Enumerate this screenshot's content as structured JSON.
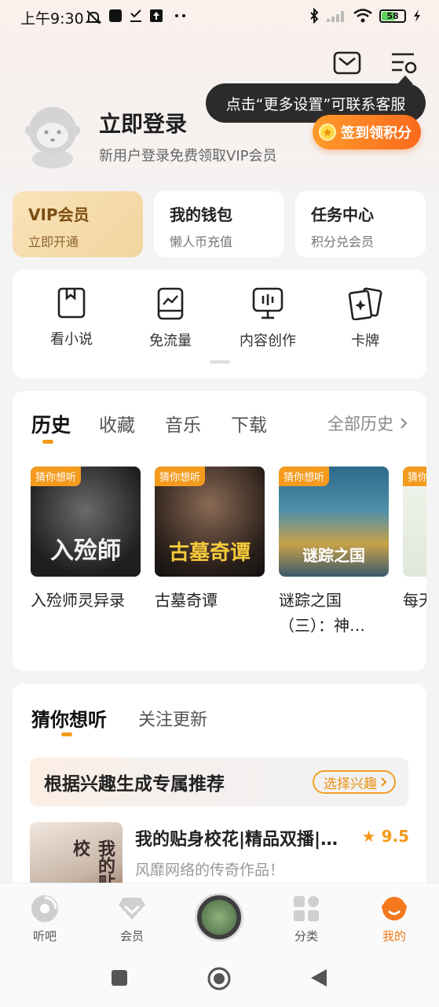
{
  "status": {
    "time": "上午9:30",
    "battery": "58"
  },
  "tooltip": {
    "text": "点击“更多设置”可联系客服"
  },
  "profile": {
    "login_title": "立即登录",
    "login_sub": "新用户登录免费领取VIP会员",
    "checkin_label": "签到领积分"
  },
  "quick": [
    {
      "title": "VIP会员",
      "sub": "立即开通"
    },
    {
      "title": "我的钱包",
      "sub": "懒人币充值"
    },
    {
      "title": "任务中心",
      "sub": "积分兑会员"
    }
  ],
  "features": [
    {
      "label": "看小说",
      "icon": "book-icon"
    },
    {
      "label": "免流量",
      "icon": "phone-traffic-icon"
    },
    {
      "label": "内容创作",
      "icon": "create-icon"
    },
    {
      "label": "卡牌",
      "icon": "cards-icon"
    }
  ],
  "history": {
    "tabs": [
      "历史",
      "收藏",
      "音乐",
      "下载"
    ],
    "all_label": "全部历史",
    "books": [
      {
        "tag": "猜你想听",
        "title": "入殓师灵异录",
        "cover_text": "入殓師",
        "cover_bg": "#3a3a3a"
      },
      {
        "tag": "猜你想听",
        "title": "古墓奇谭",
        "cover_text": "古墓奇谭",
        "cover_bg": "#2a2420"
      },
      {
        "tag": "猜你想听",
        "title": "谜踪之国（三）：神…",
        "cover_text": "谜踪之国",
        "cover_bg": "#3d6a86"
      },
      {
        "tag": "猜你想",
        "title": "每天学",
        "cover_text": "",
        "cover_bg": "#e8efe4"
      }
    ]
  },
  "guess": {
    "tabs": [
      "猜你想听",
      "关注更新"
    ],
    "interest_title": "根据兴趣生成专属推荐",
    "interest_button": "选择兴趣",
    "rec": {
      "title": "我的贴身校花|精品双播|…",
      "score": "9.5",
      "sub": "风靡网络的传奇作品！",
      "cover_text": "我的贴身校"
    }
  },
  "bottom_nav": [
    {
      "label": "听吧"
    },
    {
      "label": "会员"
    },
    {
      "label": "分类"
    },
    {
      "label": "我的"
    }
  ],
  "colors": {
    "accent": "#f29a1a",
    "checkin": "#fa6a1c",
    "vip_bg": "#f5dba8"
  }
}
